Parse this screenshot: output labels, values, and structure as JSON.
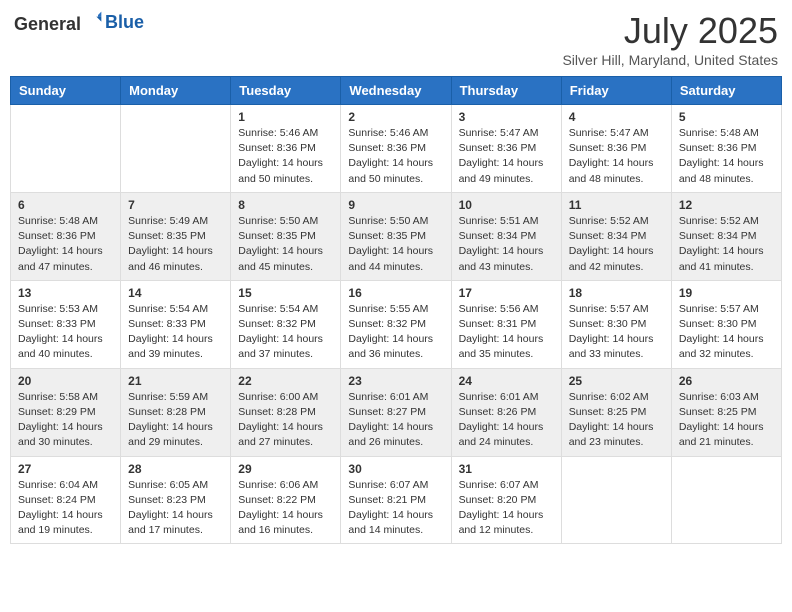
{
  "header": {
    "logo_general": "General",
    "logo_blue": "Blue",
    "month_title": "July 2025",
    "location": "Silver Hill, Maryland, United States"
  },
  "weekdays": [
    "Sunday",
    "Monday",
    "Tuesday",
    "Wednesday",
    "Thursday",
    "Friday",
    "Saturday"
  ],
  "weeks": [
    [
      {
        "day": "",
        "info": ""
      },
      {
        "day": "",
        "info": ""
      },
      {
        "day": "1",
        "info": "Sunrise: 5:46 AM\nSunset: 8:36 PM\nDaylight: 14 hours and 50 minutes."
      },
      {
        "day": "2",
        "info": "Sunrise: 5:46 AM\nSunset: 8:36 PM\nDaylight: 14 hours and 50 minutes."
      },
      {
        "day": "3",
        "info": "Sunrise: 5:47 AM\nSunset: 8:36 PM\nDaylight: 14 hours and 49 minutes."
      },
      {
        "day": "4",
        "info": "Sunrise: 5:47 AM\nSunset: 8:36 PM\nDaylight: 14 hours and 48 minutes."
      },
      {
        "day": "5",
        "info": "Sunrise: 5:48 AM\nSunset: 8:36 PM\nDaylight: 14 hours and 48 minutes."
      }
    ],
    [
      {
        "day": "6",
        "info": "Sunrise: 5:48 AM\nSunset: 8:36 PM\nDaylight: 14 hours and 47 minutes."
      },
      {
        "day": "7",
        "info": "Sunrise: 5:49 AM\nSunset: 8:35 PM\nDaylight: 14 hours and 46 minutes."
      },
      {
        "day": "8",
        "info": "Sunrise: 5:50 AM\nSunset: 8:35 PM\nDaylight: 14 hours and 45 minutes."
      },
      {
        "day": "9",
        "info": "Sunrise: 5:50 AM\nSunset: 8:35 PM\nDaylight: 14 hours and 44 minutes."
      },
      {
        "day": "10",
        "info": "Sunrise: 5:51 AM\nSunset: 8:34 PM\nDaylight: 14 hours and 43 minutes."
      },
      {
        "day": "11",
        "info": "Sunrise: 5:52 AM\nSunset: 8:34 PM\nDaylight: 14 hours and 42 minutes."
      },
      {
        "day": "12",
        "info": "Sunrise: 5:52 AM\nSunset: 8:34 PM\nDaylight: 14 hours and 41 minutes."
      }
    ],
    [
      {
        "day": "13",
        "info": "Sunrise: 5:53 AM\nSunset: 8:33 PM\nDaylight: 14 hours and 40 minutes."
      },
      {
        "day": "14",
        "info": "Sunrise: 5:54 AM\nSunset: 8:33 PM\nDaylight: 14 hours and 39 minutes."
      },
      {
        "day": "15",
        "info": "Sunrise: 5:54 AM\nSunset: 8:32 PM\nDaylight: 14 hours and 37 minutes."
      },
      {
        "day": "16",
        "info": "Sunrise: 5:55 AM\nSunset: 8:32 PM\nDaylight: 14 hours and 36 minutes."
      },
      {
        "day": "17",
        "info": "Sunrise: 5:56 AM\nSunset: 8:31 PM\nDaylight: 14 hours and 35 minutes."
      },
      {
        "day": "18",
        "info": "Sunrise: 5:57 AM\nSunset: 8:30 PM\nDaylight: 14 hours and 33 minutes."
      },
      {
        "day": "19",
        "info": "Sunrise: 5:57 AM\nSunset: 8:30 PM\nDaylight: 14 hours and 32 minutes."
      }
    ],
    [
      {
        "day": "20",
        "info": "Sunrise: 5:58 AM\nSunset: 8:29 PM\nDaylight: 14 hours and 30 minutes."
      },
      {
        "day": "21",
        "info": "Sunrise: 5:59 AM\nSunset: 8:28 PM\nDaylight: 14 hours and 29 minutes."
      },
      {
        "day": "22",
        "info": "Sunrise: 6:00 AM\nSunset: 8:28 PM\nDaylight: 14 hours and 27 minutes."
      },
      {
        "day": "23",
        "info": "Sunrise: 6:01 AM\nSunset: 8:27 PM\nDaylight: 14 hours and 26 minutes."
      },
      {
        "day": "24",
        "info": "Sunrise: 6:01 AM\nSunset: 8:26 PM\nDaylight: 14 hours and 24 minutes."
      },
      {
        "day": "25",
        "info": "Sunrise: 6:02 AM\nSunset: 8:25 PM\nDaylight: 14 hours and 23 minutes."
      },
      {
        "day": "26",
        "info": "Sunrise: 6:03 AM\nSunset: 8:25 PM\nDaylight: 14 hours and 21 minutes."
      }
    ],
    [
      {
        "day": "27",
        "info": "Sunrise: 6:04 AM\nSunset: 8:24 PM\nDaylight: 14 hours and 19 minutes."
      },
      {
        "day": "28",
        "info": "Sunrise: 6:05 AM\nSunset: 8:23 PM\nDaylight: 14 hours and 17 minutes."
      },
      {
        "day": "29",
        "info": "Sunrise: 6:06 AM\nSunset: 8:22 PM\nDaylight: 14 hours and 16 minutes."
      },
      {
        "day": "30",
        "info": "Sunrise: 6:07 AM\nSunset: 8:21 PM\nDaylight: 14 hours and 14 minutes."
      },
      {
        "day": "31",
        "info": "Sunrise: 6:07 AM\nSunset: 8:20 PM\nDaylight: 14 hours and 12 minutes."
      },
      {
        "day": "",
        "info": ""
      },
      {
        "day": "",
        "info": ""
      }
    ]
  ]
}
